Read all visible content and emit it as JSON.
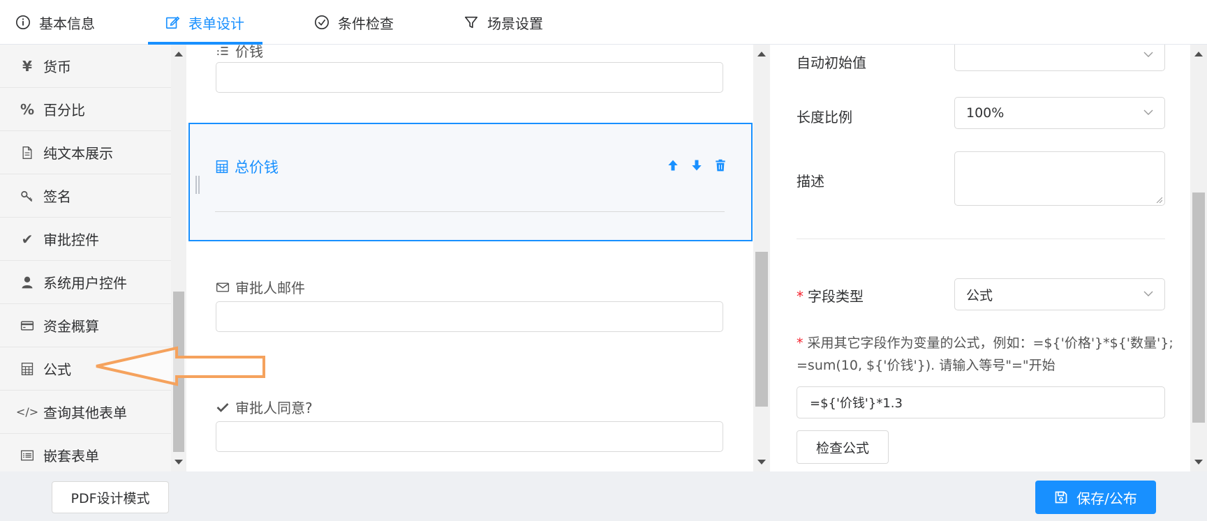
{
  "tabs": [
    {
      "label": "基本信息",
      "icon": "info-circle-icon",
      "active": false
    },
    {
      "label": "表单设计",
      "icon": "edit-icon",
      "active": true
    },
    {
      "label": "条件检查",
      "icon": "check-circle-icon",
      "active": false
    },
    {
      "label": "场景设置",
      "icon": "filter-icon",
      "active": false
    }
  ],
  "palette": {
    "items": [
      {
        "label": "货币",
        "icon": "yen-icon",
        "glyph": "¥"
      },
      {
        "label": "百分比",
        "icon": "percent-icon",
        "glyph": "%"
      },
      {
        "label": "纯文本展示",
        "icon": "document-icon",
        "glyph": ""
      },
      {
        "label": "签名",
        "icon": "key-icon",
        "glyph": ""
      },
      {
        "label": "审批控件",
        "icon": "check-icon",
        "glyph": "✔"
      },
      {
        "label": "系统用户控件",
        "icon": "user-icon",
        "glyph": ""
      },
      {
        "label": "资金概算",
        "icon": "credit-card-icon",
        "glyph": ""
      },
      {
        "label": "公式",
        "icon": "calculator-icon",
        "glyph": ""
      },
      {
        "label": "查询其他表单",
        "icon": "code-icon",
        "glyph": "</>"
      },
      {
        "label": "嵌套表单",
        "icon": "list-icon",
        "glyph": ""
      }
    ]
  },
  "canvas": {
    "fields": [
      {
        "label": "价钱",
        "icon": "list-ol-icon"
      },
      {
        "label": "审批人邮件",
        "icon": "envelope-icon"
      },
      {
        "label": "审批人同意?",
        "icon": "check-icon"
      }
    ],
    "selected": {
      "label": "总价钱",
      "icon": "calculator-icon"
    }
  },
  "properties": {
    "auto_initial_label": "自动初始值",
    "auto_initial_value": "",
    "width_ratio_label": "长度比例",
    "width_ratio_value": "100%",
    "description_label": "描述",
    "field_type_label": "字段类型",
    "field_type_value": "公式",
    "formula_help": "采用其它字段作为变量的公式，例如：=${'价格'}*${'数量'}; =sum(10, ${'价钱'}). 请输入等号\"=\"开始",
    "formula_value": "=${'价钱'}*1.3",
    "check_formula_label": "检查公式"
  },
  "bottom": {
    "pdf_mode_label": "PDF设计模式",
    "save_publish_label": "保存/公布"
  },
  "colors": {
    "accent": "#1890ff",
    "required": "#f5222d",
    "annotation_arrow": "#f5a25d"
  }
}
